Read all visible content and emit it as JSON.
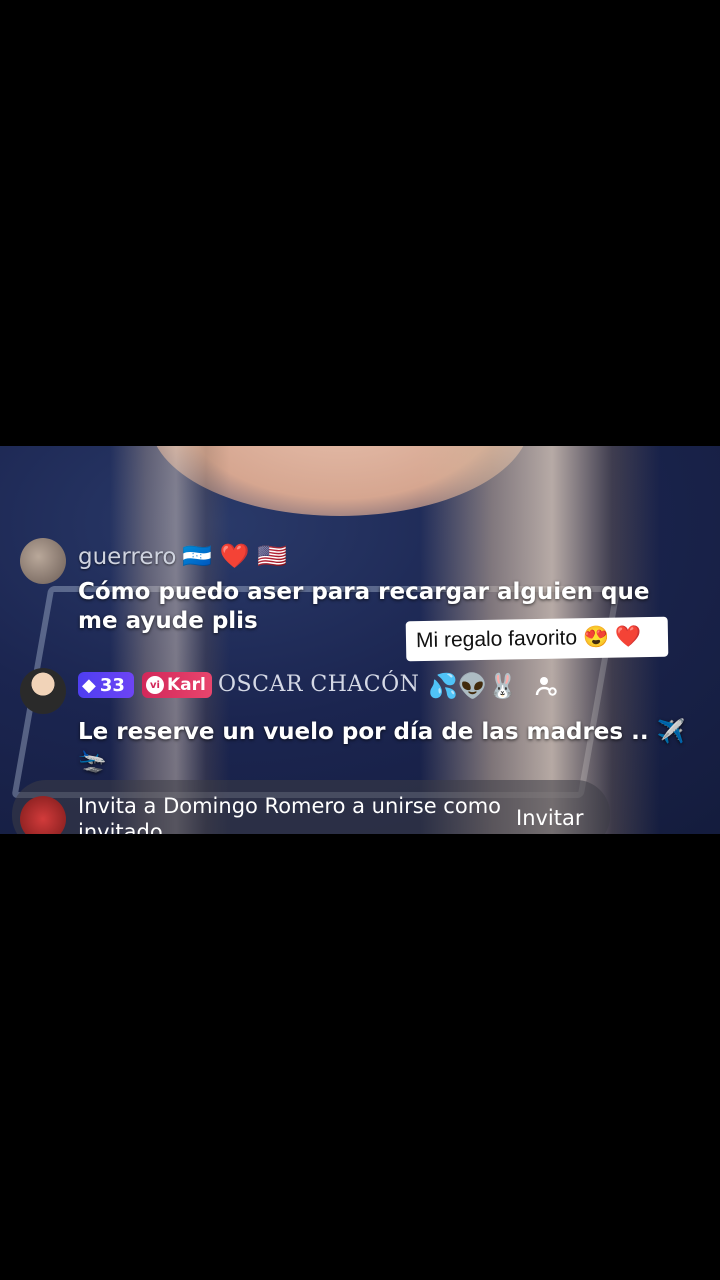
{
  "comments": [
    {
      "username": "guerrero",
      "emojis": "🇭🇳 ❤️ 🇺🇸",
      "message": "Cómo puedo aser para recargar alguien que me ayude plis"
    },
    {
      "diamond_level": "33",
      "fan_badge": "Karl",
      "fan_icon": "vi",
      "username": "OSCAR CHACÓN",
      "emojis": "💦👽🐰",
      "message": "Le reserve un vuelo por día de las madres .. ✈️🛬"
    }
  ],
  "gift_sticker": "Mi regalo favorito 😍 ❤️",
  "invite": {
    "text": "Invita a Domingo Romero a unirse como invitado",
    "button": "Invitar"
  },
  "colors": {
    "background": "#000000",
    "diamond_badge": "#5a40f2",
    "fan_badge": "#e03a62"
  }
}
